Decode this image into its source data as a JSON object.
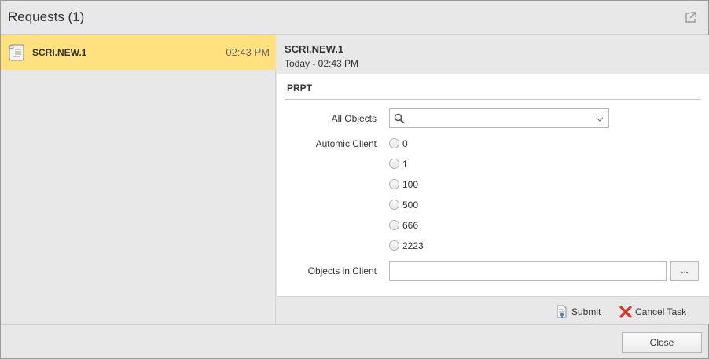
{
  "window": {
    "title": "Requests (1)"
  },
  "requests": [
    {
      "name": "SCRI.NEW.1",
      "time": "02:43 PM"
    }
  ],
  "detail": {
    "title": "SCRI.NEW.1",
    "subtitle": "Today - 02:43 PM",
    "section_title": "PRPT",
    "all_objects_label": "All Objects",
    "all_objects_value": "",
    "client_label": "Automic Client",
    "client_options": [
      "0",
      "1",
      "100",
      "500",
      "666",
      "2223"
    ],
    "objects_in_client_label": "Objects in Client",
    "objects_in_client_value": "",
    "browse_label": "..."
  },
  "actions": {
    "submit_label": "Submit",
    "cancel_label": "Cancel Task"
  },
  "footer": {
    "close_label": "Close"
  },
  "colors": {
    "selected_row": "#ffe17f",
    "panel_bg": "#e8e8e8",
    "cancel_icon": "#d9342b",
    "submit_icon": "#4a7fc1"
  },
  "icons": {
    "popout": "popout-icon",
    "request": "script-document-icon",
    "search": "search-icon",
    "dropdown": "chevron-down-icon",
    "submit": "submit-document-icon",
    "cancel": "red-x-icon"
  }
}
